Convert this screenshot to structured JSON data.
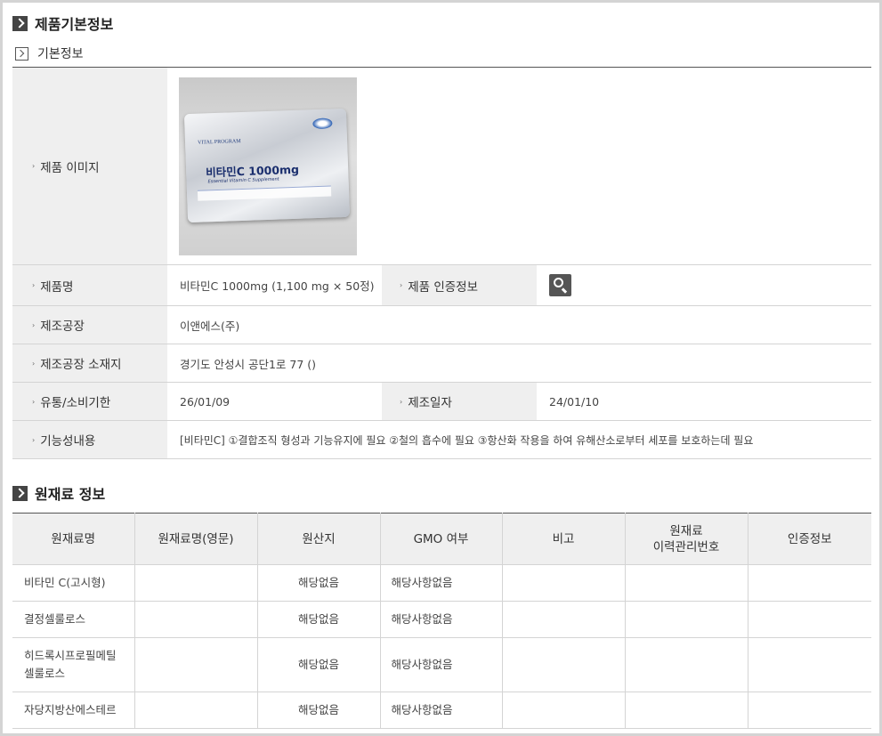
{
  "section1": {
    "title": "제품기본정보",
    "subtitle": "기본정보"
  },
  "basic": {
    "image_label": "제품 이미지",
    "image": {
      "brand_text": "VITAL PROGRAM",
      "pack_name": "비타민C 1000mg",
      "pack_sub": "Essential Vitamin C Supplement"
    },
    "name_label": "제품명",
    "name_value": "비타민C 1000mg (1,100 mg × 50정)",
    "cert_label": "제품 인증정보",
    "factory_label": "제조공장",
    "factory_value": "이앤에스(주)",
    "location_label": "제조공장 소재지",
    "location_value": "경기도 안성시 공단1로 77 ()",
    "expiry_label": "유통/소비기한",
    "expiry_value": "26/01/09",
    "mfg_label": "제조일자",
    "mfg_value": "24/01/10",
    "function_label": "기능성내용",
    "function_value": "[비타민C] ①결합조직 형성과 기능유지에 필요 ②철의 흡수에 필요 ③항산화 작용을 하여 유해산소로부터 세포를 보호하는데 필요"
  },
  "section2": {
    "title": "원재료 정보"
  },
  "materials": {
    "headers": [
      "원재료명",
      "원재료명(영문)",
      "원산지",
      "GMO 여부",
      "비고",
      "원재료\n이력관리번호",
      "인증정보"
    ],
    "header_lines": {
      "history_line1": "원재료",
      "history_line2": "이력관리번호"
    },
    "rows": [
      {
        "name": "비타민 C(고시형)",
        "name_en": "",
        "origin": "해당없음",
        "gmo": "해당사항없음",
        "note": "",
        "history": "",
        "cert": ""
      },
      {
        "name": "결정셀룰로스",
        "name_en": "",
        "origin": "해당없음",
        "gmo": "해당사항없음",
        "note": "",
        "history": "",
        "cert": ""
      },
      {
        "name_line1": "히드록시프로필메틸",
        "name_line2": "셀룰로스",
        "name_en": "",
        "origin": "해당없음",
        "gmo": "해당사항없음",
        "note": "",
        "history": "",
        "cert": ""
      },
      {
        "name": "자당지방산에스테르",
        "name_en": "",
        "origin": "해당없음",
        "gmo": "해당사항없음",
        "note": "",
        "history": "",
        "cert": ""
      }
    ]
  },
  "icons": {
    "section_icon": "chevron-right-box-icon",
    "sub_icon": "chevron-right-outline-box-icon",
    "search_icon": "search-icon",
    "bullet_icon": "small-arrow-icon"
  }
}
